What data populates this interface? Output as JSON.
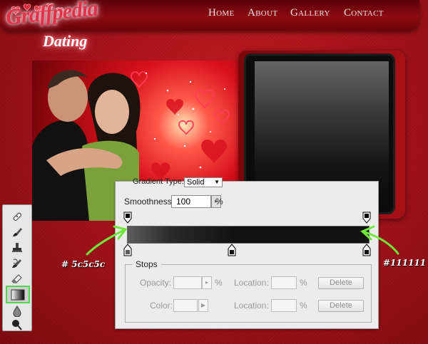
{
  "site": {
    "logo_line1": "Graffpedia",
    "logo_line2": "Dating",
    "nav": [
      "Home",
      "About",
      "Gallery",
      "Contact"
    ]
  },
  "gradient_editor": {
    "gradient_type_label": "Gradient Type:",
    "gradient_type_value": "Solid",
    "smoothness_label": "Smoothness:",
    "smoothness_value": "100",
    "smoothness_unit": "%",
    "stops_title": "Stops",
    "opacity_label": "Opacity:",
    "opacity_unit": "%",
    "location_label": "Location:",
    "location_unit": "%",
    "color_label": "Color:",
    "delete_label": "Delete"
  },
  "annotations": {
    "left_color": "# 5c5c5c",
    "right_color": "#111111",
    "arrow_color": "#6ee83a"
  },
  "tools": [
    "healing-brush-icon",
    "brush-icon",
    "clone-stamp-icon",
    "history-brush-icon",
    "eraser-icon",
    "gradient-icon",
    "blur-icon",
    "dodge-icon"
  ]
}
